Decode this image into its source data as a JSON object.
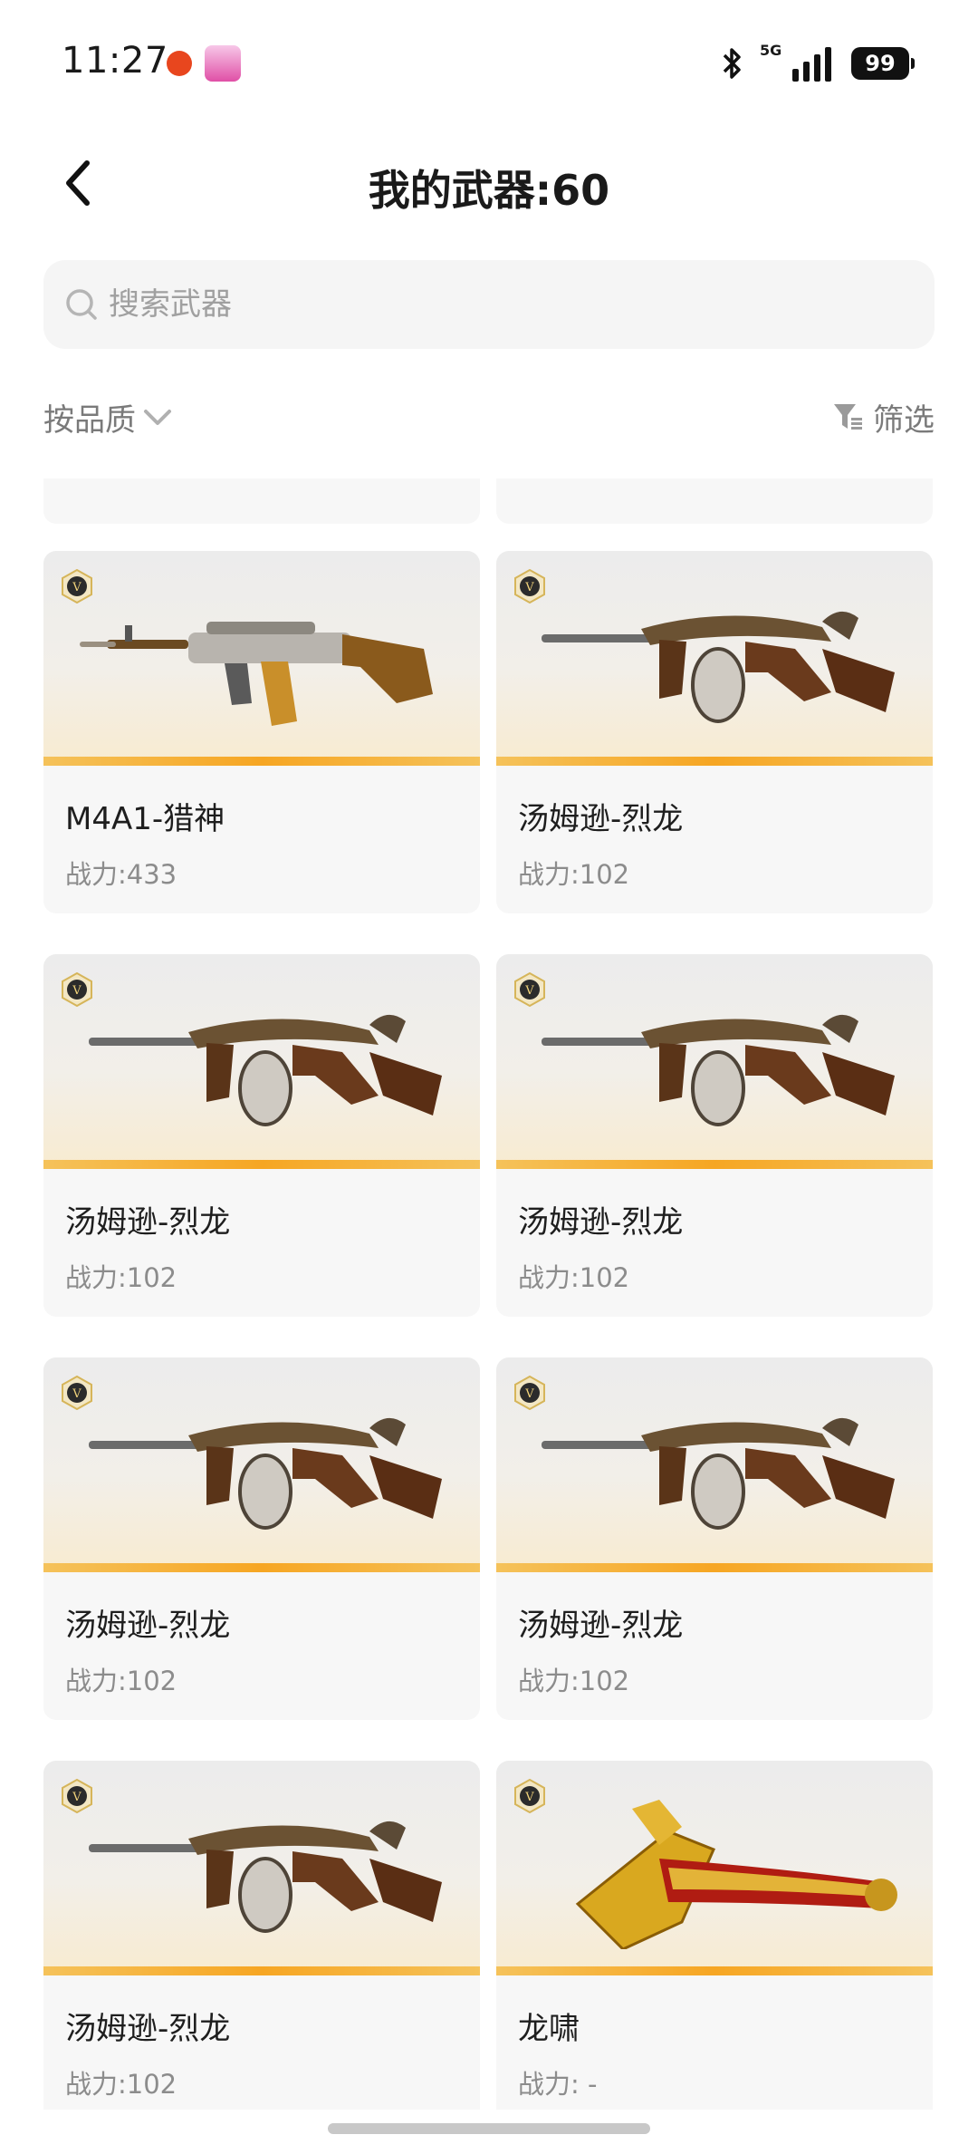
{
  "status_bar": {
    "time": "11:27",
    "network": "5G",
    "battery": "99",
    "icons": [
      "app-notification-icon",
      "app-notification-icon-2",
      "bluetooth-icon",
      "signal-icon",
      "battery-icon"
    ]
  },
  "header": {
    "title": "我的武器:60",
    "back_icon": "chevron-left-icon"
  },
  "search": {
    "placeholder": "搜索武器",
    "value": ""
  },
  "filters": {
    "sort_label": "按品质",
    "filter_label": "筛选"
  },
  "colors": {
    "rarity_strip": "#f6a623",
    "badge": "#c7a54a",
    "card_bg": "#f7f7f7",
    "secondary_text": "#8c8c8c"
  },
  "weapons": [
    {
      "name": "M4A1-猎神",
      "power": "战力:433",
      "type": "rifle"
    },
    {
      "name": "汤姆逊-烈龙",
      "power": "战力:102",
      "type": "smg"
    },
    {
      "name": "汤姆逊-烈龙",
      "power": "战力:102",
      "type": "smg"
    },
    {
      "name": "汤姆逊-烈龙",
      "power": "战力:102",
      "type": "smg"
    },
    {
      "name": "汤姆逊-烈龙",
      "power": "战力:102",
      "type": "smg"
    },
    {
      "name": "汤姆逊-烈龙",
      "power": "战力:102",
      "type": "smg"
    },
    {
      "name": "汤姆逊-烈龙",
      "power": "战力:102",
      "type": "smg"
    },
    {
      "name": "龙啸",
      "power": "战力: -",
      "type": "axe"
    }
  ]
}
